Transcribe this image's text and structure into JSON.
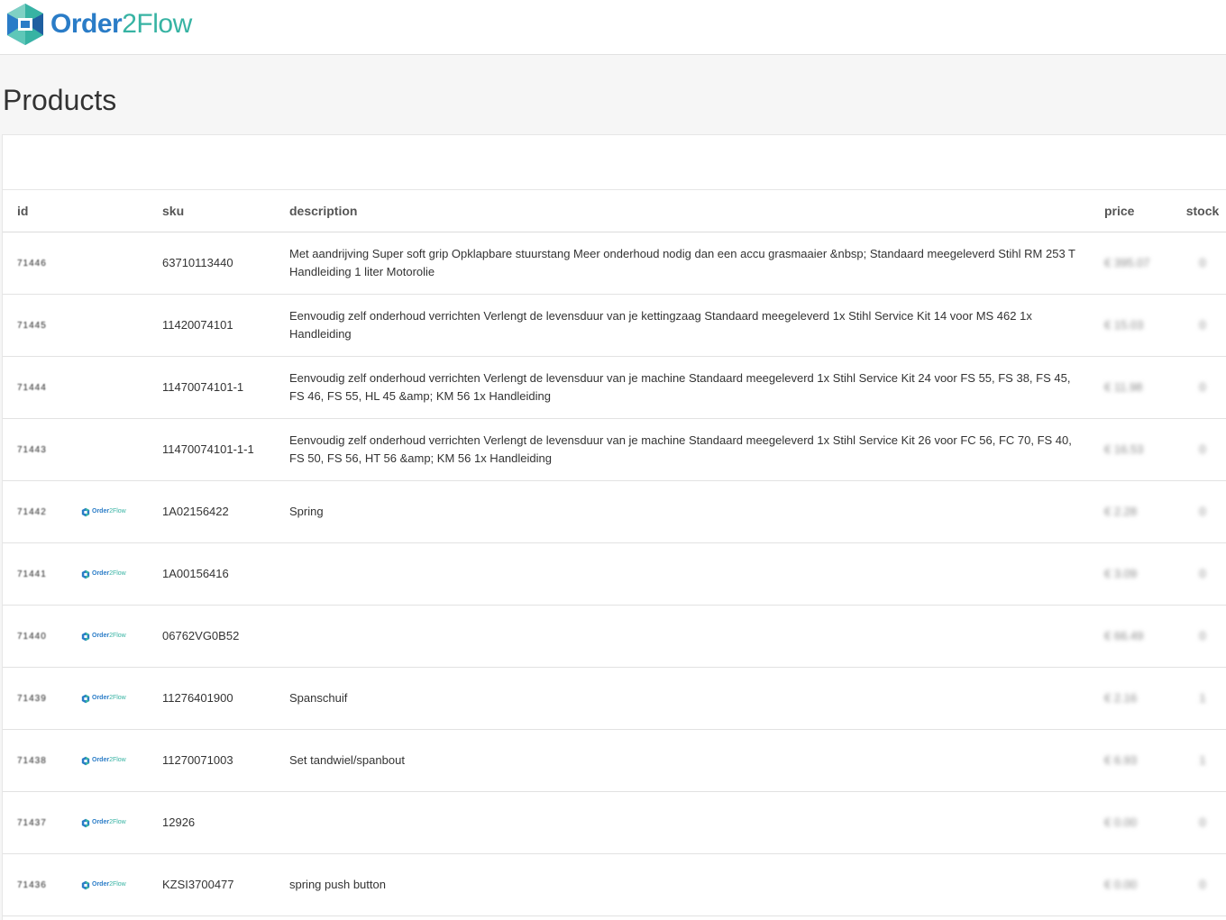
{
  "app": {
    "logo_text_a": "Order",
    "logo_text_b": "2Flow"
  },
  "page": {
    "title": "Products"
  },
  "table": {
    "columns": {
      "id": "id",
      "sku": "sku",
      "description": "description",
      "price": "price",
      "stock": "stock"
    },
    "rows": [
      {
        "id": "71446",
        "has_image": false,
        "sku": "63710113440",
        "description": "Met aandrijving Super soft grip Opklapbare stuurstang Meer onderhoud nodig dan een accu grasmaaier &nbsp; Standaard meegeleverd Stihl RM 253 T Handleiding 1 liter Motorolie",
        "price": "€ 395.07",
        "stock": "0"
      },
      {
        "id": "71445",
        "has_image": false,
        "sku": "11420074101",
        "description": "Eenvoudig zelf onderhoud verrichten Verlengt de levensduur van je kettingzaag Standaard meegeleverd 1x Stihl Service Kit 14 voor MS 462 1x Handleiding",
        "price": "€ 15.03",
        "stock": "0"
      },
      {
        "id": "71444",
        "has_image": false,
        "sku": "11470074101-1",
        "description": "Eenvoudig zelf onderhoud verrichten Verlengt de levensduur van je machine Standaard meegeleverd 1x Stihl Service Kit 24 voor FS 55, FS 38, FS 45, FS 46, FS 55, HL 45 &amp; KM 56 1x Handleiding",
        "price": "€ 11.98",
        "stock": "0"
      },
      {
        "id": "71443",
        "has_image": false,
        "sku": "11470074101-1-1",
        "description": "Eenvoudig zelf onderhoud verrichten Verlengt de levensduur van je machine Standaard meegeleverd 1x Stihl Service Kit 26 voor FC 56, FC 70, FS 40, FS 50, FS 56, HT 56 &amp; KM 56 1x Handleiding",
        "price": "€ 16.53",
        "stock": "0"
      },
      {
        "id": "71442",
        "has_image": true,
        "sku": "1A02156422",
        "description": "Spring",
        "price": "€ 2.28",
        "stock": "0"
      },
      {
        "id": "71441",
        "has_image": true,
        "sku": "1A00156416",
        "description": "",
        "price": "€ 3.09",
        "stock": "0"
      },
      {
        "id": "71440",
        "has_image": true,
        "sku": "06762VG0B52",
        "description": "",
        "price": "€ 66.49",
        "stock": "0"
      },
      {
        "id": "71439",
        "has_image": true,
        "sku": "11276401900",
        "description": "Spanschuif",
        "price": "€ 2.16",
        "stock": "1"
      },
      {
        "id": "71438",
        "has_image": true,
        "sku": "11270071003",
        "description": "Set tandwiel/spanbout",
        "price": "€ 6.93",
        "stock": "1"
      },
      {
        "id": "71437",
        "has_image": true,
        "sku": "12926",
        "description": "",
        "price": "€ 0.00",
        "stock": "0"
      },
      {
        "id": "71436",
        "has_image": true,
        "sku": "KZSI3700477",
        "description": "spring push button",
        "price": "€ 0.00",
        "stock": "0"
      }
    ]
  },
  "thumb_text_a": "Order",
  "thumb_text_b": "2Flow",
  "colors": {
    "brand_blue": "#2a7cc7",
    "brand_teal": "#37b3a3"
  }
}
